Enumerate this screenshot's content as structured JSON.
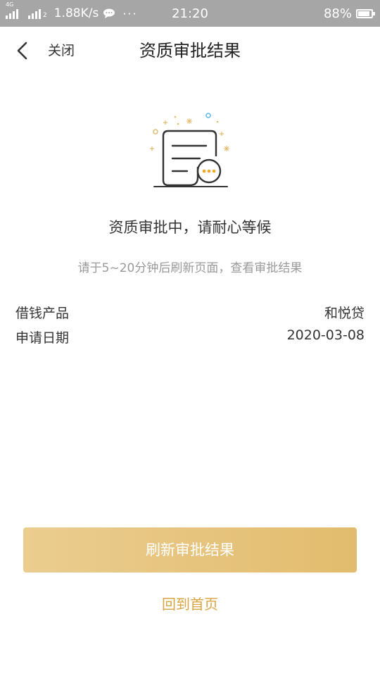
{
  "status_bar": {
    "network_tag_1": "4G",
    "network_tag_2": "2",
    "speed": "1.88K/s",
    "more": "···",
    "time": "21:20",
    "battery": "88%",
    "battery_level": 0.88
  },
  "nav": {
    "close_label": "关闭",
    "title": "资质审批结果"
  },
  "main": {
    "status_title": "资质审批中，请耐心等候",
    "status_desc": "请于5~20分钟后刷新页面，查看审批结果",
    "rows": [
      {
        "label": "借钱产品",
        "value": "和悦贷"
      },
      {
        "label": "申请日期",
        "value": "2020-03-08"
      }
    ]
  },
  "actions": {
    "refresh_label": "刷新审批结果",
    "home_label": "回到首页"
  },
  "colors": {
    "status_bar_bg": "#a6a6a6",
    "button_gradient_start": "#ebcd8f",
    "button_gradient_end": "#e2bc6e",
    "link_gold": "#d8a542",
    "pending_dots": "#f5a623"
  }
}
